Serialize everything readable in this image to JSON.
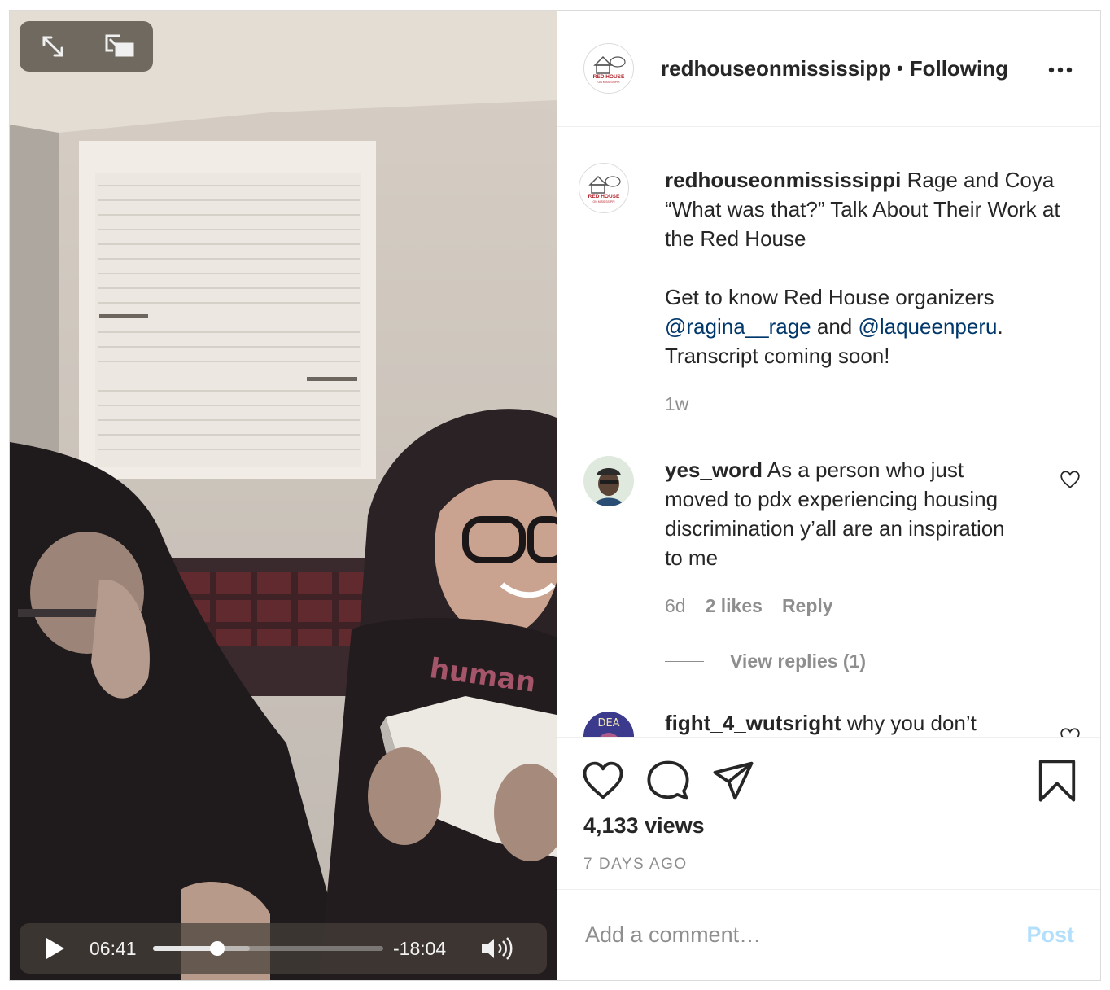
{
  "video": {
    "elapsed": "06:41",
    "remaining": "-18:04",
    "progress_fraction": 0.28,
    "buffered_fraction": 0.42,
    "print_text": "human"
  },
  "header": {
    "username": "redhouseonmississippi",
    "separator": "•",
    "follow_status": "Following",
    "logo_line1": "RED HOUSE",
    "logo_line2": "ON MISSISSIPPI"
  },
  "caption": {
    "username": "redhouseonmississippi",
    "title_text": " Rage and Coya “What was that?” Talk About Their Work at the Red House",
    "body_prefix": "Get to know Red House organizers ",
    "mention1": "@ragina__rage",
    "between": " and ",
    "mention2": "@laqueenperu",
    "body_suffix": ". Transcript coming soon!",
    "age": "1w"
  },
  "comments": [
    {
      "username": "yes_word",
      "text": " As a person who just moved to pdx experiencing housing discrimination y’all are an inspiration to me",
      "age": "6d",
      "likes": "2 likes",
      "reply_label": "Reply",
      "view_replies": "View replies (1)"
    },
    {
      "username": "fight_4_wutsright",
      "text": " why you don’t"
    }
  ],
  "actions": {
    "views": "4,133 views",
    "posted": "7 DAYS AGO"
  },
  "comment_box": {
    "placeholder": "Add a comment…",
    "post_label": "Post"
  },
  "colors": {
    "mention": "#00376b",
    "muted": "#8e8e8e",
    "post_button": "#b2dffc"
  },
  "icons": [
    "expand-icon",
    "picture-in-picture-icon",
    "play-icon",
    "volume-icon",
    "more-icon",
    "heart-icon",
    "comment-icon",
    "share-icon",
    "bookmark-icon"
  ]
}
